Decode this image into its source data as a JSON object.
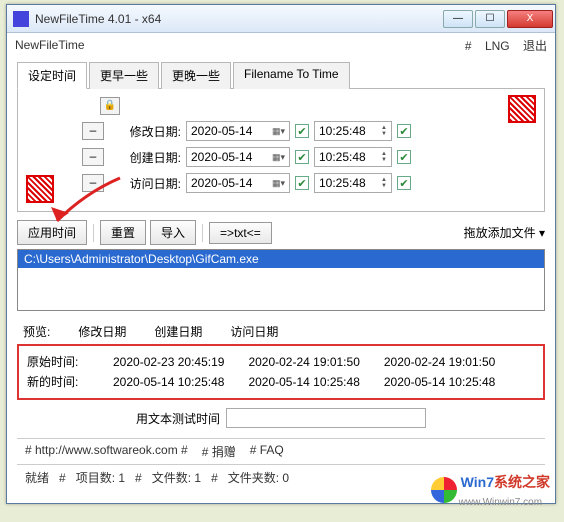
{
  "window": {
    "title": "NewFileTime 4.01 - x64"
  },
  "menubar": {
    "appname": "NewFileTime",
    "hash": "#",
    "lng": "LNG",
    "exit": "退出"
  },
  "tabs": [
    "设定时间",
    "更早一些",
    "更晚一些",
    "Filename To Time"
  ],
  "rows": {
    "modify": {
      "label": "修改日期:",
      "date": "2020-05-14",
      "time": "10:25:48"
    },
    "create": {
      "label": "创建日期:",
      "date": "2020-05-14",
      "time": "10:25:48"
    },
    "access": {
      "label": "访问日期:",
      "date": "2020-05-14",
      "time": "10:25:48"
    }
  },
  "buttons": {
    "apply": "应用时间",
    "reset": "重置",
    "import": "导入",
    "txt": "=>txt<=",
    "drop": "拖放添加文件",
    "minus": "–"
  },
  "filelist": {
    "selected": "C:\\Users\\Administrator\\Desktop\\GifCam.exe"
  },
  "preview": {
    "title": "预览:",
    "cols": [
      "修改日期",
      "创建日期",
      "访问日期"
    ],
    "orig": {
      "label": "原始时间:",
      "m": "2020-02-23 20:45:19",
      "c": "2020-02-24 19:01:50",
      "a": "2020-02-24 19:01:50"
    },
    "new": {
      "label": "新的时间:",
      "m": "2020-05-14 10:25:48",
      "c": "2020-05-14 10:25:48",
      "a": "2020-05-14 10:25:48"
    }
  },
  "testrow": {
    "label": "用文本测试时间"
  },
  "footer1": {
    "site": "# http://www.softwareok.com #",
    "donate": "# 捐赠",
    "faq": "# FAQ"
  },
  "footer2": {
    "ready": "就绪",
    "sep": "#",
    "items": "项目数: 1",
    "files": "文件数: 1",
    "folders": "文件夹数: 0"
  },
  "watermark": {
    "t1": "Win7",
    "t2": "系统之家",
    "sub": "www.Winwin7.com"
  }
}
